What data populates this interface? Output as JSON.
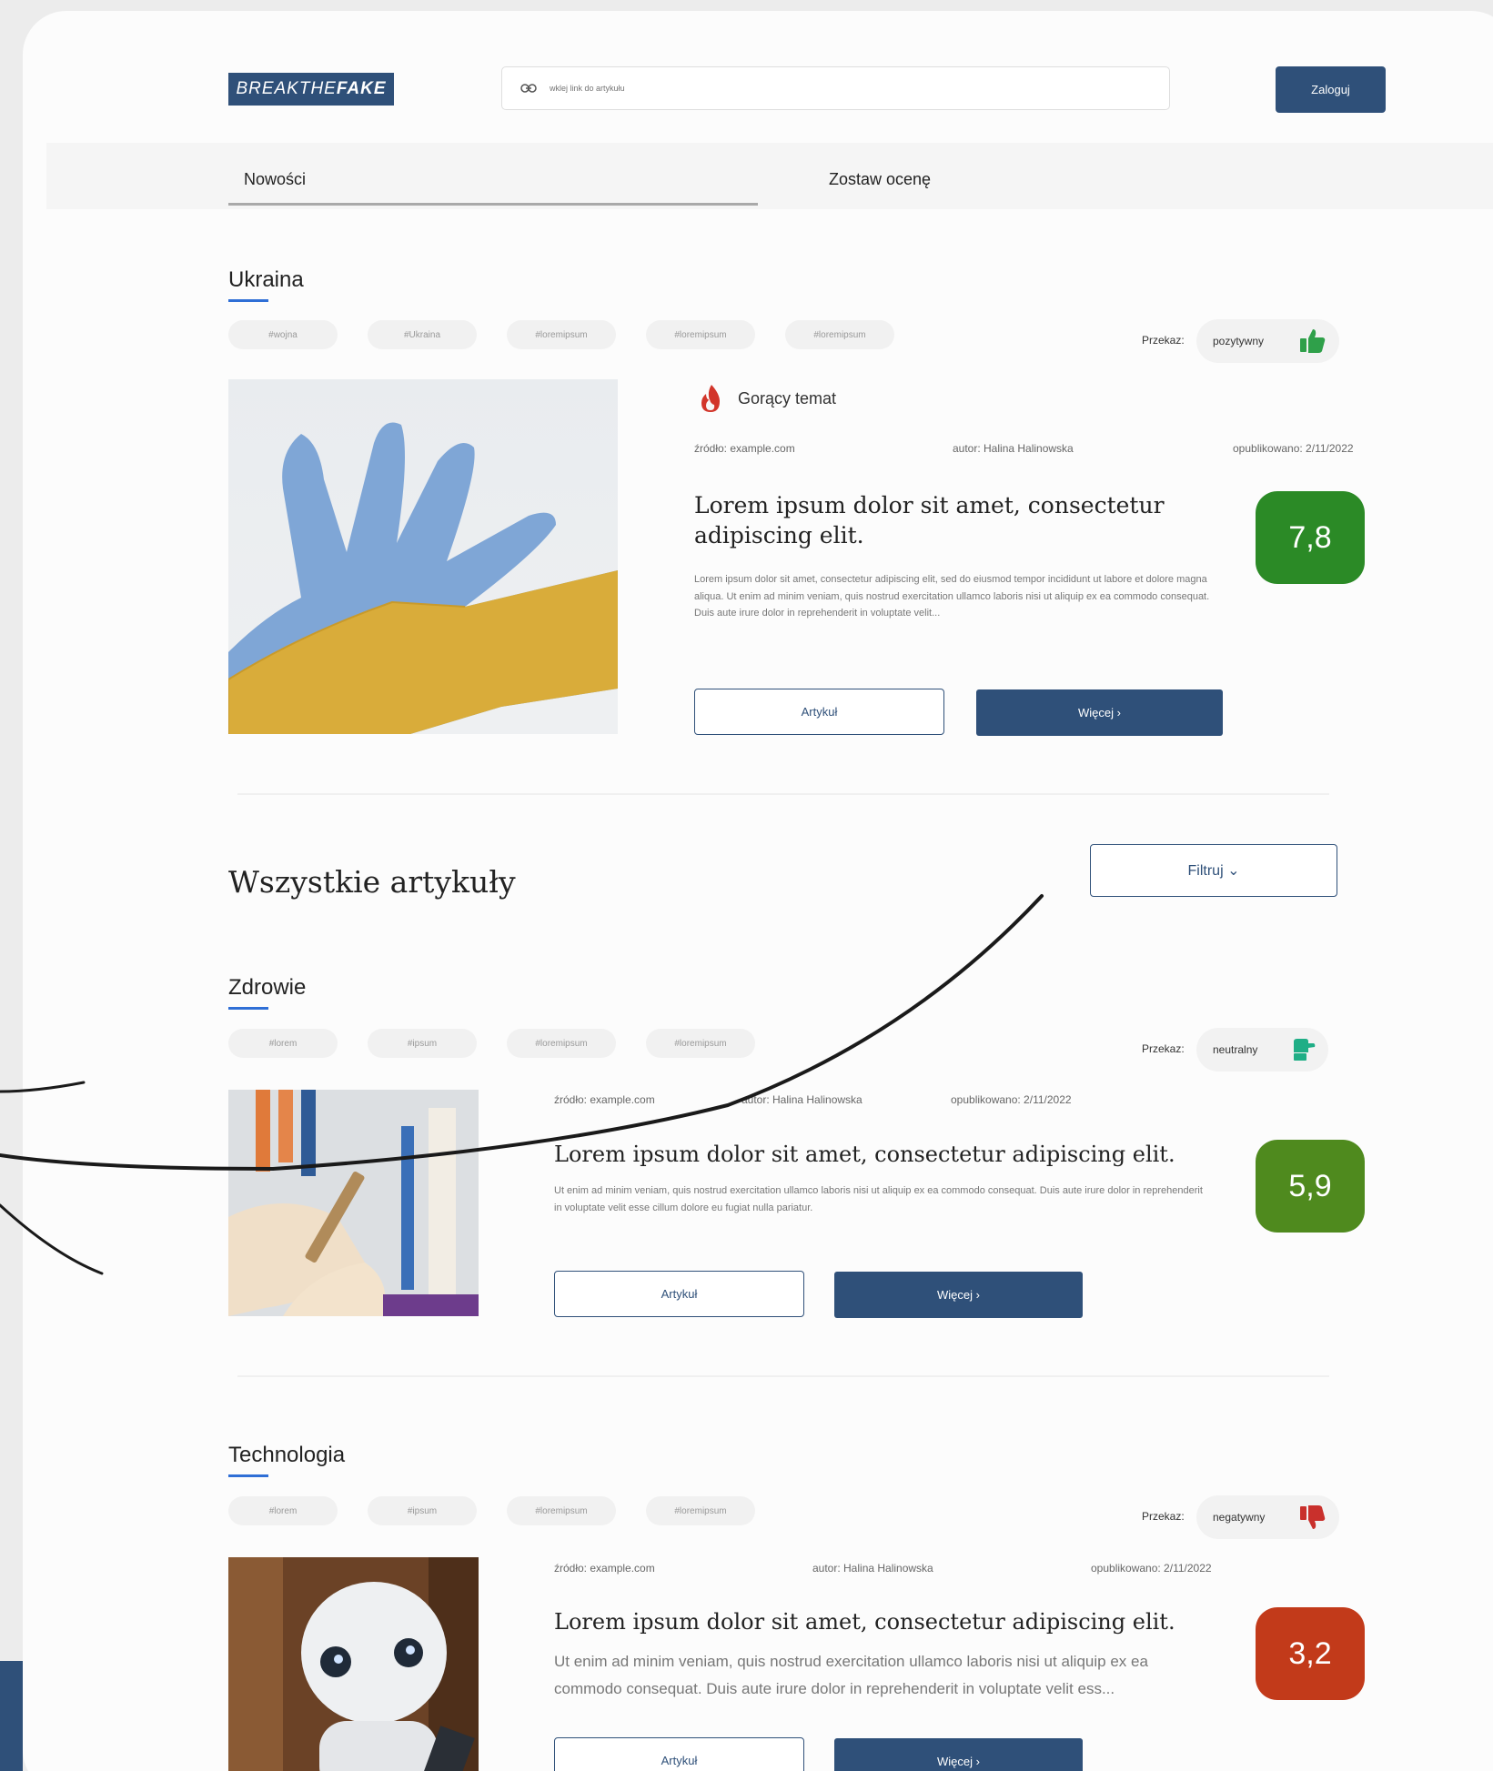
{
  "header": {
    "logo_part1": "BREAKTHE",
    "logo_part2": "FAKE",
    "search_placeholder": "wklej link do artykułu",
    "login_label": "Zaloguj"
  },
  "tabs": [
    {
      "label": "Nowości"
    },
    {
      "label": "Zostaw ocenę"
    }
  ],
  "featured": {
    "section_title": "Ukraina",
    "tags": [
      "#wojna",
      "#Ukraina",
      "#loremipsum",
      "#loremipsum",
      "#loremipsum"
    ],
    "przekaz_label": "Przekaz:",
    "przekaz_value": "pozytywny",
    "hot_label": "Gorący temat",
    "source": "źródło:  example.com",
    "author": "autor:  Halina Halinowska",
    "published": "opublikowano:  2/11/2022",
    "headline": "Lorem ipsum dolor sit amet, consectetur adipiscing elit.",
    "excerpt": "Lorem ipsum dolor sit amet, consectetur adipiscing elit, sed do eiusmod tempor incididunt ut labore et dolore magna aliqua. Ut enim ad minim veniam, quis nostrud exercitation ullamco laboris nisi ut aliquip ex ea commodo consequat. Duis aute irure dolor in reprehenderit in voluptate velit...",
    "score": "7,8",
    "score_color": "#2b8a26",
    "article_label": "Artykuł",
    "more_label": "Więcej  ›"
  },
  "all_articles": {
    "title": "Wszystkie artykuły",
    "filter_label": "Filtruj  ⌄"
  },
  "articles": [
    {
      "section_title": "Zdrowie",
      "tags": [
        "#lorem",
        "#ipsum",
        "#loremipsum",
        "#loremipsum"
      ],
      "przekaz_label": "Przekaz:",
      "przekaz_value": "neutralny",
      "source": "źródło:  example.com",
      "author": "autor:  Halina Halinowska",
      "published": "opublikowano:  2/11/2022",
      "headline": "Lorem ipsum dolor sit amet, consectetur adipiscing elit.",
      "excerpt": "Ut enim ad minim veniam, quis nostrud exercitation ullamco laboris nisi ut aliquip ex ea commodo consequat. Duis aute irure dolor in reprehenderit in voluptate velit esse cillum dolore eu fugiat nulla pariatur.",
      "score": "5,9",
      "score_color": "#4f8a1e",
      "article_label": "Artykuł",
      "more_label": "Więcej  ›"
    },
    {
      "section_title": "Technologia",
      "tags": [
        "#lorem",
        "#ipsum",
        "#loremipsum",
        "#loremipsum"
      ],
      "przekaz_label": "Przekaz:",
      "przekaz_value": "negatywny",
      "source": "źródło:  example.com",
      "author": "autor:  Halina Halinowska",
      "published": "opublikowano:  2/11/2022",
      "headline": "Lorem ipsum dolor sit amet, consectetur adipiscing elit.",
      "excerpt": "Ut enim ad minim veniam, quis nostrud exercitation ullamco laboris nisi ut aliquip ex ea commodo consequat. Duis aute irure dolor in reprehenderit in voluptate velit ess...",
      "score": "3,2",
      "score_color": "#c23a1a",
      "article_label": "Artykuł",
      "more_label": "Więcej  ›"
    }
  ],
  "icons": {
    "link": "link-icon",
    "flame": "flame-icon",
    "thumb_up": "thumb-up-icon",
    "thumb_side": "thumb-side-icon",
    "thumb_down": "thumb-down-icon"
  },
  "colors": {
    "primary": "#2f5079",
    "accent_underline": "#2f6fd6",
    "positive": "#2fa04a",
    "neutral": "#1fae86",
    "negative": "#c9302c"
  }
}
